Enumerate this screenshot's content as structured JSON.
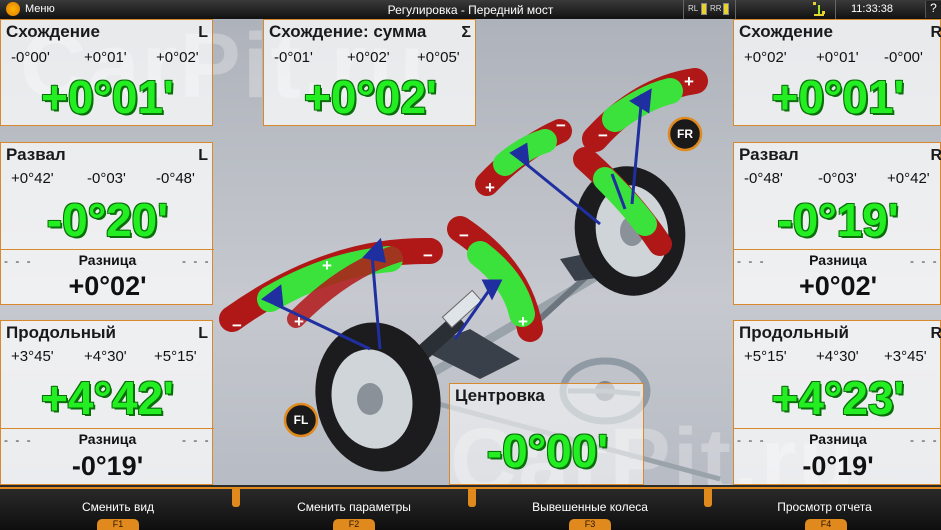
{
  "topbar": {
    "menu_label": "Меню",
    "title": "Регулировка - Передний мост",
    "sensor_rl": "RL",
    "sensor_rr": "RR",
    "clock": "11:33:38",
    "help": "?"
  },
  "watermark": "CarPit.ru",
  "left": {
    "toe": {
      "title": "Схождение",
      "side": "L",
      "min": "-0°00'",
      "mid": "+0°01'",
      "max": "+0°02'",
      "value": "+0°01'"
    },
    "camber": {
      "title": "Развал",
      "side": "L",
      "min": "+0°42'",
      "mid": "-0°03'",
      "max": "-0°48'",
      "value": "-0°20'",
      "diff_label": "Разница",
      "diff_value": "+0°02'"
    },
    "caster": {
      "title": "Продольный",
      "side": "L",
      "min": "+3°45'",
      "mid": "+4°30'",
      "max": "+5°15'",
      "value": "+4°42'",
      "diff_label": "Разница",
      "diff_value": "-0°19'"
    }
  },
  "total_toe": {
    "title": "Схождение: сумма",
    "side": "Σ",
    "min": "-0°01'",
    "mid": "+0°02'",
    "max": "+0°05'",
    "value": "+0°02'"
  },
  "right": {
    "toe": {
      "title": "Схождение",
      "side": "R",
      "min": "+0°02'",
      "mid": "+0°01'",
      "max": "-0°00'",
      "value": "+0°01'"
    },
    "camber": {
      "title": "Развал",
      "side": "R",
      "min": "-0°48'",
      "mid": "-0°03'",
      "max": "+0°42'",
      "value": "-0°19'",
      "diff_label": "Разница",
      "diff_value": "+0°02'"
    },
    "caster": {
      "title": "Продольный",
      "side": "R",
      "min": "+5°15'",
      "mid": "+4°30'",
      "max": "+3°45'",
      "value": "+4°23'",
      "diff_label": "Разница",
      "diff_value": "-0°19'"
    }
  },
  "center": {
    "title": "Центровка",
    "value": "-0°00'"
  },
  "wheel_labels": {
    "fl": "FL",
    "fr": "FR"
  },
  "dashes": "- - -",
  "toolbar": [
    {
      "label": "Сменить вид",
      "key": "F1"
    },
    {
      "label": "Сменить параметры",
      "key": "F2"
    },
    {
      "label": "Вывешенные колеса",
      "key": "F3"
    },
    {
      "label": "Просмотр отчета",
      "key": "F4"
    }
  ],
  "colors": {
    "accent": "#e08a1e",
    "value_green": "#22ee22",
    "scale_green": "#3ce23c",
    "scale_red": "#b01818"
  }
}
